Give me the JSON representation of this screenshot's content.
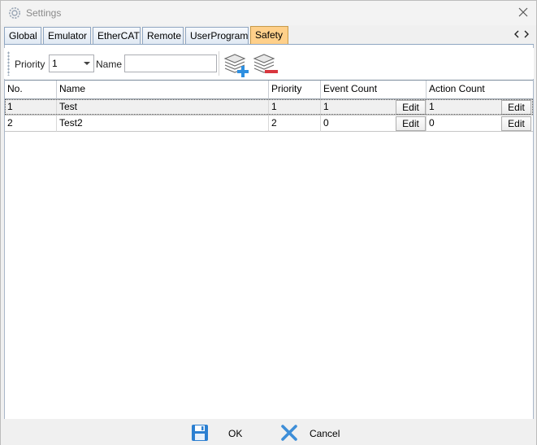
{
  "window": {
    "title": "Settings"
  },
  "tabs": [
    {
      "label": "Global"
    },
    {
      "label": "Emulator"
    },
    {
      "label": "EtherCAT"
    },
    {
      "label": "Remote"
    },
    {
      "label": "UserProgram"
    },
    {
      "label": "Safety",
      "active": true
    }
  ],
  "toolbar": {
    "priority_label": "Priority",
    "priority_value": "1",
    "name_label": "Name",
    "name_value": "",
    "add_icon": "add-layer-icon",
    "remove_icon": "remove-layer-icon"
  },
  "table": {
    "columns": [
      "No.",
      "Name",
      "Priority",
      "Event Count",
      "Action Count"
    ],
    "edit_label": "Edit",
    "rows": [
      {
        "no": "1",
        "name": "Test",
        "priority": "1",
        "event_count": "1",
        "action_count": "1",
        "selected": true
      },
      {
        "no": "2",
        "name": "Test2",
        "priority": "2",
        "event_count": "0",
        "action_count": "0",
        "selected": false
      }
    ]
  },
  "footer": {
    "ok_label": "OK",
    "cancel_label": "Cancel",
    "ok_icon": "save-icon",
    "cancel_icon": "close-x-icon"
  },
  "colors": {
    "active_tab": "#ffd08a",
    "tab_border": "#8fa6c2",
    "ok_icon": "#2b7fd1",
    "cancel_icon": "#3d8ed8"
  }
}
